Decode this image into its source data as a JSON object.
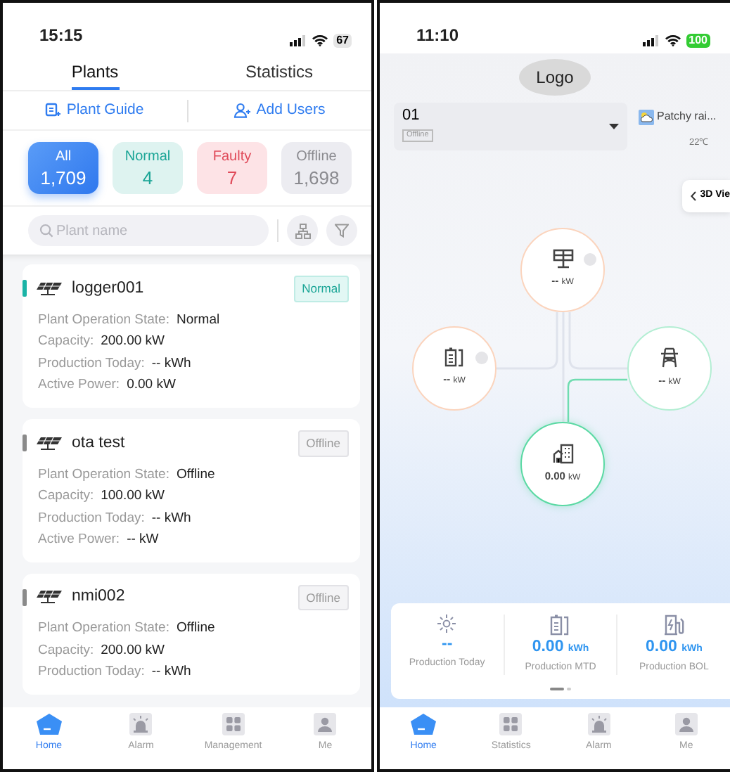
{
  "left_screen": {
    "status_bar": {
      "time": "15:15",
      "battery": "67"
    },
    "tabs": [
      {
        "label": "Plants",
        "selected": true
      },
      {
        "label": "Statistics",
        "selected": false
      }
    ],
    "actions": [
      {
        "label": "Plant Guide",
        "kind": "guide"
      },
      {
        "label": "Add Users",
        "kind": "users"
      }
    ],
    "filters": [
      {
        "label": "All",
        "count": "1,709",
        "kind": "all",
        "selected": true
      },
      {
        "label": "Normal",
        "count": "4",
        "kind": "normal",
        "selected": false
      },
      {
        "label": "Faulty",
        "count": "7",
        "kind": "faulty",
        "selected": false
      },
      {
        "label": "Offline",
        "count": "1,698",
        "kind": "offline",
        "selected": false
      }
    ],
    "search": {
      "placeholder": "Plant name"
    },
    "plants": [
      {
        "name": "logger001",
        "status": "Normal",
        "kind": "normal",
        "fields": [
          {
            "label": "Plant Operation State:",
            "value": "Normal"
          },
          {
            "label": "Capacity:",
            "value": "200.00 kW"
          },
          {
            "label": "Production Today:",
            "value": "-- kWh"
          },
          {
            "label": "Active Power:",
            "value": "0.00 kW"
          }
        ]
      },
      {
        "name": "ota test",
        "status": "Offline",
        "kind": "offline",
        "fields": [
          {
            "label": "Plant Operation State:",
            "value": "Offline"
          },
          {
            "label": "Capacity:",
            "value": "100.00 kW"
          },
          {
            "label": "Production Today:",
            "value": "-- kWh"
          },
          {
            "label": "Active Power:",
            "value": "-- kW"
          }
        ]
      },
      {
        "name": "nmi002",
        "status": "Offline",
        "kind": "offline",
        "fields": [
          {
            "label": "Plant Operation State:",
            "value": "Offline"
          },
          {
            "label": "Capacity:",
            "value": "200.00 kW"
          },
          {
            "label": "Production Today:",
            "value": "-- kWh"
          }
        ]
      }
    ],
    "nav": [
      {
        "label": "Home",
        "kind": "home",
        "selected": true
      },
      {
        "label": "Alarm",
        "kind": "alarm",
        "selected": false
      },
      {
        "label": "Management",
        "kind": "grid",
        "selected": false
      },
      {
        "label": "Me",
        "kind": "me",
        "selected": false
      }
    ]
  },
  "right_screen": {
    "status_bar": {
      "time": "11:10",
      "battery": "100"
    },
    "logo": "Logo",
    "device": {
      "name": "01",
      "status": "Offline"
    },
    "weather": {
      "text": "Patchy rai...",
      "temperature": "22℃"
    },
    "view_button": "3D Vie",
    "flow_nodes": [
      {
        "kind": "pv",
        "value": "--",
        "unit": "kW",
        "expandable": true
      },
      {
        "kind": "battery",
        "value": "--",
        "unit": "kW",
        "expandable": true
      },
      {
        "kind": "grid",
        "value": "--",
        "unit": "kW",
        "expandable": false
      },
      {
        "kind": "load",
        "value": "0.00",
        "unit": "kW",
        "expandable": false
      }
    ],
    "stats": [
      {
        "kind": "sun",
        "value": "--",
        "label": "Production Today"
      },
      {
        "kind": "battery",
        "value": "0.00",
        "unit": "kWh",
        "label": "Production MTD"
      },
      {
        "kind": "charger",
        "value": "0.00",
        "unit": "kWh",
        "label": "Production BOL"
      }
    ],
    "pages": [
      {
        "selected": true
      },
      {
        "selected": false
      }
    ],
    "nav": [
      {
        "label": "Home",
        "kind": "home",
        "selected": true
      },
      {
        "label": "Statistics",
        "kind": "grid",
        "selected": false
      },
      {
        "label": "Alarm",
        "kind": "alarm",
        "selected": false
      },
      {
        "label": "Me",
        "kind": "me",
        "selected": false
      }
    ]
  }
}
